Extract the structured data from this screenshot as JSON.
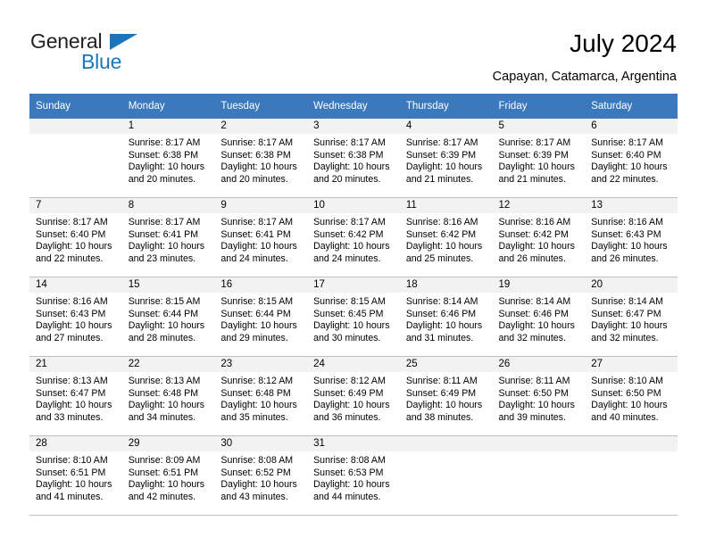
{
  "brand": {
    "name_top": "General",
    "name_bottom": "Blue",
    "accent_color": "#1b75bb"
  },
  "header": {
    "title": "July 2024",
    "subtitle": "Capayan, Catamarca, Argentina"
  },
  "calendar": {
    "header_color": "#3b78bc",
    "daynum_band_color": "#f2f2f2",
    "weekdays": [
      "Sunday",
      "Monday",
      "Tuesday",
      "Wednesday",
      "Thursday",
      "Friday",
      "Saturday"
    ],
    "weeks": [
      [
        {
          "day": "",
          "empty": true,
          "sunrise": "",
          "sunset": "",
          "daylight_line1": "",
          "daylight_line2": ""
        },
        {
          "day": "1",
          "sunrise": "Sunrise: 8:17 AM",
          "sunset": "Sunset: 6:38 PM",
          "daylight_line1": "Daylight: 10 hours",
          "daylight_line2": "and 20 minutes."
        },
        {
          "day": "2",
          "sunrise": "Sunrise: 8:17 AM",
          "sunset": "Sunset: 6:38 PM",
          "daylight_line1": "Daylight: 10 hours",
          "daylight_line2": "and 20 minutes."
        },
        {
          "day": "3",
          "sunrise": "Sunrise: 8:17 AM",
          "sunset": "Sunset: 6:38 PM",
          "daylight_line1": "Daylight: 10 hours",
          "daylight_line2": "and 20 minutes."
        },
        {
          "day": "4",
          "sunrise": "Sunrise: 8:17 AM",
          "sunset": "Sunset: 6:39 PM",
          "daylight_line1": "Daylight: 10 hours",
          "daylight_line2": "and 21 minutes."
        },
        {
          "day": "5",
          "sunrise": "Sunrise: 8:17 AM",
          "sunset": "Sunset: 6:39 PM",
          "daylight_line1": "Daylight: 10 hours",
          "daylight_line2": "and 21 minutes."
        },
        {
          "day": "6",
          "sunrise": "Sunrise: 8:17 AM",
          "sunset": "Sunset: 6:40 PM",
          "daylight_line1": "Daylight: 10 hours",
          "daylight_line2": "and 22 minutes."
        }
      ],
      [
        {
          "day": "7",
          "sunrise": "Sunrise: 8:17 AM",
          "sunset": "Sunset: 6:40 PM",
          "daylight_line1": "Daylight: 10 hours",
          "daylight_line2": "and 22 minutes."
        },
        {
          "day": "8",
          "sunrise": "Sunrise: 8:17 AM",
          "sunset": "Sunset: 6:41 PM",
          "daylight_line1": "Daylight: 10 hours",
          "daylight_line2": "and 23 minutes."
        },
        {
          "day": "9",
          "sunrise": "Sunrise: 8:17 AM",
          "sunset": "Sunset: 6:41 PM",
          "daylight_line1": "Daylight: 10 hours",
          "daylight_line2": "and 24 minutes."
        },
        {
          "day": "10",
          "sunrise": "Sunrise: 8:17 AM",
          "sunset": "Sunset: 6:42 PM",
          "daylight_line1": "Daylight: 10 hours",
          "daylight_line2": "and 24 minutes."
        },
        {
          "day": "11",
          "sunrise": "Sunrise: 8:16 AM",
          "sunset": "Sunset: 6:42 PM",
          "daylight_line1": "Daylight: 10 hours",
          "daylight_line2": "and 25 minutes."
        },
        {
          "day": "12",
          "sunrise": "Sunrise: 8:16 AM",
          "sunset": "Sunset: 6:42 PM",
          "daylight_line1": "Daylight: 10 hours",
          "daylight_line2": "and 26 minutes."
        },
        {
          "day": "13",
          "sunrise": "Sunrise: 8:16 AM",
          "sunset": "Sunset: 6:43 PM",
          "daylight_line1": "Daylight: 10 hours",
          "daylight_line2": "and 26 minutes."
        }
      ],
      [
        {
          "day": "14",
          "sunrise": "Sunrise: 8:16 AM",
          "sunset": "Sunset: 6:43 PM",
          "daylight_line1": "Daylight: 10 hours",
          "daylight_line2": "and 27 minutes."
        },
        {
          "day": "15",
          "sunrise": "Sunrise: 8:15 AM",
          "sunset": "Sunset: 6:44 PM",
          "daylight_line1": "Daylight: 10 hours",
          "daylight_line2": "and 28 minutes."
        },
        {
          "day": "16",
          "sunrise": "Sunrise: 8:15 AM",
          "sunset": "Sunset: 6:44 PM",
          "daylight_line1": "Daylight: 10 hours",
          "daylight_line2": "and 29 minutes."
        },
        {
          "day": "17",
          "sunrise": "Sunrise: 8:15 AM",
          "sunset": "Sunset: 6:45 PM",
          "daylight_line1": "Daylight: 10 hours",
          "daylight_line2": "and 30 minutes."
        },
        {
          "day": "18",
          "sunrise": "Sunrise: 8:14 AM",
          "sunset": "Sunset: 6:46 PM",
          "daylight_line1": "Daylight: 10 hours",
          "daylight_line2": "and 31 minutes."
        },
        {
          "day": "19",
          "sunrise": "Sunrise: 8:14 AM",
          "sunset": "Sunset: 6:46 PM",
          "daylight_line1": "Daylight: 10 hours",
          "daylight_line2": "and 32 minutes."
        },
        {
          "day": "20",
          "sunrise": "Sunrise: 8:14 AM",
          "sunset": "Sunset: 6:47 PM",
          "daylight_line1": "Daylight: 10 hours",
          "daylight_line2": "and 32 minutes."
        }
      ],
      [
        {
          "day": "21",
          "sunrise": "Sunrise: 8:13 AM",
          "sunset": "Sunset: 6:47 PM",
          "daylight_line1": "Daylight: 10 hours",
          "daylight_line2": "and 33 minutes."
        },
        {
          "day": "22",
          "sunrise": "Sunrise: 8:13 AM",
          "sunset": "Sunset: 6:48 PM",
          "daylight_line1": "Daylight: 10 hours",
          "daylight_line2": "and 34 minutes."
        },
        {
          "day": "23",
          "sunrise": "Sunrise: 8:12 AM",
          "sunset": "Sunset: 6:48 PM",
          "daylight_line1": "Daylight: 10 hours",
          "daylight_line2": "and 35 minutes."
        },
        {
          "day": "24",
          "sunrise": "Sunrise: 8:12 AM",
          "sunset": "Sunset: 6:49 PM",
          "daylight_line1": "Daylight: 10 hours",
          "daylight_line2": "and 36 minutes."
        },
        {
          "day": "25",
          "sunrise": "Sunrise: 8:11 AM",
          "sunset": "Sunset: 6:49 PM",
          "daylight_line1": "Daylight: 10 hours",
          "daylight_line2": "and 38 minutes."
        },
        {
          "day": "26",
          "sunrise": "Sunrise: 8:11 AM",
          "sunset": "Sunset: 6:50 PM",
          "daylight_line1": "Daylight: 10 hours",
          "daylight_line2": "and 39 minutes."
        },
        {
          "day": "27",
          "sunrise": "Sunrise: 8:10 AM",
          "sunset": "Sunset: 6:50 PM",
          "daylight_line1": "Daylight: 10 hours",
          "daylight_line2": "and 40 minutes."
        }
      ],
      [
        {
          "day": "28",
          "sunrise": "Sunrise: 8:10 AM",
          "sunset": "Sunset: 6:51 PM",
          "daylight_line1": "Daylight: 10 hours",
          "daylight_line2": "and 41 minutes."
        },
        {
          "day": "29",
          "sunrise": "Sunrise: 8:09 AM",
          "sunset": "Sunset: 6:51 PM",
          "daylight_line1": "Daylight: 10 hours",
          "daylight_line2": "and 42 minutes."
        },
        {
          "day": "30",
          "sunrise": "Sunrise: 8:08 AM",
          "sunset": "Sunset: 6:52 PM",
          "daylight_line1": "Daylight: 10 hours",
          "daylight_line2": "and 43 minutes."
        },
        {
          "day": "31",
          "sunrise": "Sunrise: 8:08 AM",
          "sunset": "Sunset: 6:53 PM",
          "daylight_line1": "Daylight: 10 hours",
          "daylight_line2": "and 44 minutes."
        },
        {
          "day": "",
          "empty": true,
          "sunrise": "",
          "sunset": "",
          "daylight_line1": "",
          "daylight_line2": ""
        },
        {
          "day": "",
          "empty": true,
          "sunrise": "",
          "sunset": "",
          "daylight_line1": "",
          "daylight_line2": ""
        },
        {
          "day": "",
          "empty": true,
          "sunrise": "",
          "sunset": "",
          "daylight_line1": "",
          "daylight_line2": ""
        }
      ]
    ]
  }
}
